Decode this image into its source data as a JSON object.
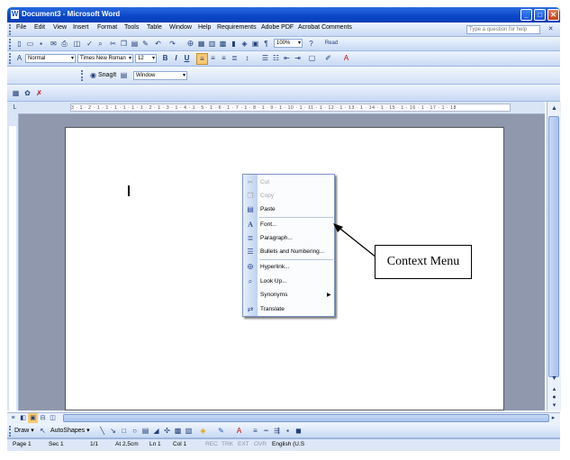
{
  "window": {
    "title": "Document3 - Microsoft Word",
    "help_placeholder": "Type a question for help"
  },
  "menu": [
    "File",
    "Edit",
    "View",
    "Insert",
    "Format",
    "Tools",
    "Table",
    "Window",
    "Help",
    "Requirements",
    "Adobe PDF",
    "Acrobat Comments"
  ],
  "standard_toolbar": {
    "zoom": "100%",
    "read_label": "Read"
  },
  "formatting_toolbar": {
    "style": "Normal",
    "font": "Times New Roman",
    "size": "12"
  },
  "snagit_toolbar": {
    "snagit_label": "SnagIt",
    "capture_mode": "Window"
  },
  "ruler": {
    "ticks": "3 · 1 · 2 · 1 · 1 · 1 · 1 · 1 · 1 · 2 · 1 · 3 · 1 · 4 · 1 · 5 · 1 · 6 · 1 · 7 · 1 · 8 · 1 · 9 · 1 · 10 · 1 · 11 · 1 · 12 · 1 · 13 · 1 · 14 · 1 · 15 · 1 · 16 · 1 · 17 · 1 · 18"
  },
  "context_menu": {
    "items": [
      {
        "label": "Cut",
        "icon": "scissors-icon",
        "enabled": false
      },
      {
        "label": "Copy",
        "icon": "copy-icon",
        "enabled": false
      },
      {
        "label": "Paste",
        "icon": "paste-icon",
        "enabled": true
      },
      {
        "label": "Font...",
        "icon": "font-icon",
        "enabled": true
      },
      {
        "label": "Paragraph...",
        "icon": "paragraph-icon",
        "enabled": true
      },
      {
        "label": "Bullets and Numbering...",
        "icon": "bullets-icon",
        "enabled": true
      },
      {
        "label": "Hyperlink...",
        "icon": "hyperlink-icon",
        "enabled": true
      },
      {
        "label": "Look Up...",
        "icon": "lookup-icon",
        "enabled": true
      },
      {
        "label": "Synonyms",
        "icon": "",
        "enabled": true,
        "submenu": true
      },
      {
        "label": "Translate",
        "icon": "translate-icon",
        "enabled": true
      }
    ]
  },
  "callout": {
    "text": "Context Menu"
  },
  "drawing_toolbar": {
    "draw_label": "Draw",
    "autoshapes_label": "AutoShapes"
  },
  "status": {
    "page": "Page 1",
    "section": "Sec 1",
    "pages": "1/1",
    "at": "At 2,5cm",
    "line": "Ln 1",
    "col": "Col 1",
    "rec": "REC",
    "trk": "TRK",
    "ext": "EXT",
    "ovr": "OVR",
    "language": "English (U.S"
  }
}
